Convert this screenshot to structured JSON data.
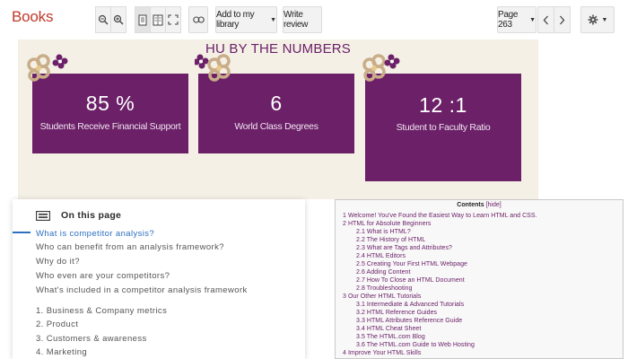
{
  "toolbar": {
    "brand": "Books",
    "add_to_library": "Add to my library",
    "write_review": "Write review",
    "page": "Page 263"
  },
  "infographic": {
    "title": "HU BY THE NUMBERS",
    "stats": [
      {
        "value": "85 %",
        "label": "Students Receive Financial Support"
      },
      {
        "value": "6",
        "label": "World Class Degrees"
      },
      {
        "value": "12 :1",
        "label": "Student to Faculty Ratio"
      }
    ],
    "colors": {
      "card": "#6b2068",
      "background": "#f4f0e6",
      "flower": "#c9ad88"
    }
  },
  "on_this_page": {
    "title": "On this page",
    "items": [
      "What is competitor analysis?",
      "Who can benefit from an analysis framework?",
      "Why do it?",
      "Who even are your competitors?",
      "What's included in a competitor analysis framework",
      "1. Business & Company metrics",
      "2. Product",
      "3. Customers & awareness",
      "4. Marketing"
    ]
  },
  "contents": {
    "title": "Contents",
    "hide_label": "[hide]",
    "items": [
      "1 Welcome! You've Found the Easiest Way to Learn HTML and CSS.",
      "2 HTML for Absolute Beginners",
      "2.1 What is HTML?",
      "2.2 The History of HTML",
      "2.3 What are Tags and Attributes?",
      "2.4 HTML Editors",
      "2.5 Creating Your First HTML Webpage",
      "2.6 Adding Content",
      "2.7 How To Close an HTML Document",
      "2.8 Troubleshooting",
      "3 Our Other HTML Tutorials",
      "3.1 Intermediate & Advanced Tutorials",
      "3.2 HTML Reference Guides",
      "3.3 HTML Attributes Reference Guide",
      "3.4 HTML Cheat Sheet",
      "3.5 The HTML.com Blog",
      "3.6 The HTML.com Guide to Web Hosting",
      "4 Improve Your HTML Skills"
    ]
  }
}
